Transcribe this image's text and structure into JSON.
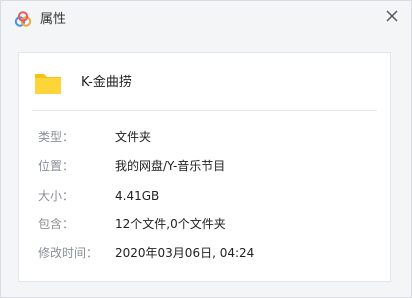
{
  "window": {
    "title": "属性",
    "logo_icon": "baidu-netdisk-cloud-icon",
    "close_icon": "close-icon",
    "accent_colors": [
      "#e85b5b",
      "#4a90e2",
      "#f3a73b"
    ]
  },
  "file": {
    "icon": "folder-icon",
    "icon_color": "#f5c21b",
    "name": "K-金曲捞"
  },
  "properties": [
    {
      "label": "类型：",
      "value": "文件夹"
    },
    {
      "label": "位置：",
      "value": "我的网盘/Y-音乐节目"
    },
    {
      "label": "大小：",
      "value": "4.41GB"
    },
    {
      "label": "包含：",
      "value": "12个文件,0个文件夹"
    },
    {
      "label": "修改时间：",
      "value": "2020年03月06日, 04:24"
    }
  ]
}
